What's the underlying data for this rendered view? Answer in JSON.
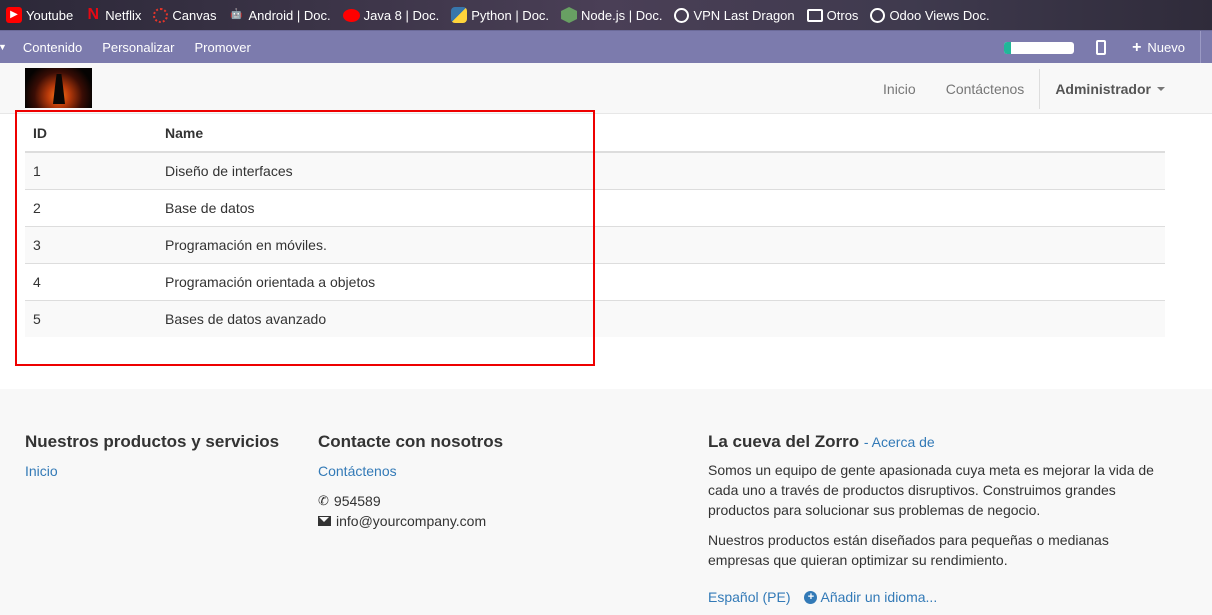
{
  "bookmarks": [
    {
      "label": "Youtube",
      "icon": "youtube-icon"
    },
    {
      "label": "Netflix",
      "icon": "netflix-icon"
    },
    {
      "label": "Canvas",
      "icon": "canvas-icon"
    },
    {
      "label": "Android | Doc.",
      "icon": "android-icon"
    },
    {
      "label": "Java 8 | Doc.",
      "icon": "java-icon"
    },
    {
      "label": "Python | Doc.",
      "icon": "python-icon"
    },
    {
      "label": "Node.js |  Doc.",
      "icon": "nodejs-icon"
    },
    {
      "label": "VPN Last Dragon",
      "icon": "globe-icon"
    },
    {
      "label": "Otros",
      "icon": "folder-icon"
    },
    {
      "label": "Odoo Views Doc.",
      "icon": "globe-icon"
    }
  ],
  "odoo_bar": {
    "menu": [
      "Contenido",
      "Personalizar",
      "Promover"
    ],
    "nuevo_label": "Nuevo",
    "progress_fraction": 0.1
  },
  "site_nav": {
    "links": [
      "Inicio",
      "Contáctenos"
    ],
    "user": "Administrador"
  },
  "table": {
    "headers": [
      "ID",
      "Name"
    ],
    "rows": [
      [
        "1",
        "Diseño de interfaces"
      ],
      [
        "2",
        "Base de datos"
      ],
      [
        "3",
        "Programación en móviles."
      ],
      [
        "4",
        "Programación orientada a objetos"
      ],
      [
        "5",
        "Bases de datos avanzado"
      ]
    ]
  },
  "footer": {
    "col1": {
      "title": "Nuestros productos y servicios",
      "link": "Inicio"
    },
    "col2": {
      "title": "Contacte con nosotros",
      "link": "Contáctenos",
      "phone": "954589",
      "email": "info@yourcompany.com"
    },
    "col3": {
      "title": "La cueva del Zorro",
      "about": "- Acerca de",
      "para1": "Somos un equipo de gente apasionada cuya meta es mejorar la vida de cada uno a través de productos disruptivos. Construimos grandes productos para solucionar sus problemas de negocio.",
      "para2": "Nuestros productos están diseñados para pequeñas o medianas empresas que quieran optimizar su rendimiento.",
      "lang": "Español (PE)",
      "add_lang": "Añadir un idioma..."
    }
  },
  "colors": {
    "odoo_bar": "#7c7bad",
    "link": "#337ab7",
    "highlight": "#ee0000"
  }
}
